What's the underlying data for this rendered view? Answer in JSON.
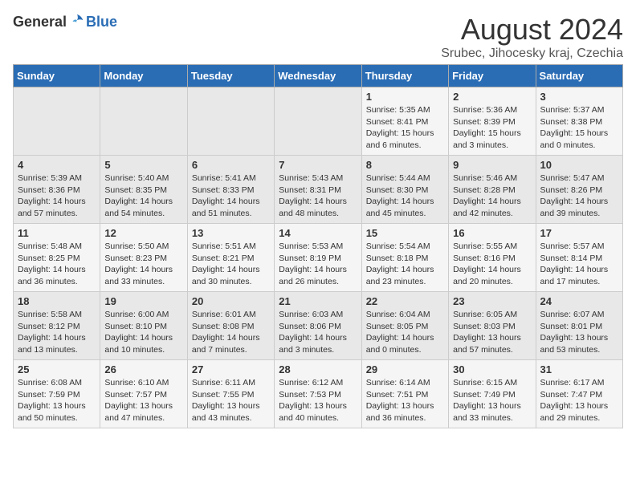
{
  "logo": {
    "general": "General",
    "blue": "Blue"
  },
  "title": "August 2024",
  "subtitle": "Srubec, Jihocesky kraj, Czechia",
  "weekdays": [
    "Sunday",
    "Monday",
    "Tuesday",
    "Wednesday",
    "Thursday",
    "Friday",
    "Saturday"
  ],
  "weeks": [
    [
      {
        "day": "",
        "info": ""
      },
      {
        "day": "",
        "info": ""
      },
      {
        "day": "",
        "info": ""
      },
      {
        "day": "",
        "info": ""
      },
      {
        "day": "1",
        "info": "Sunrise: 5:35 AM\nSunset: 8:41 PM\nDaylight: 15 hours\nand 6 minutes."
      },
      {
        "day": "2",
        "info": "Sunrise: 5:36 AM\nSunset: 8:39 PM\nDaylight: 15 hours\nand 3 minutes."
      },
      {
        "day": "3",
        "info": "Sunrise: 5:37 AM\nSunset: 8:38 PM\nDaylight: 15 hours\nand 0 minutes."
      }
    ],
    [
      {
        "day": "4",
        "info": "Sunrise: 5:39 AM\nSunset: 8:36 PM\nDaylight: 14 hours\nand 57 minutes."
      },
      {
        "day": "5",
        "info": "Sunrise: 5:40 AM\nSunset: 8:35 PM\nDaylight: 14 hours\nand 54 minutes."
      },
      {
        "day": "6",
        "info": "Sunrise: 5:41 AM\nSunset: 8:33 PM\nDaylight: 14 hours\nand 51 minutes."
      },
      {
        "day": "7",
        "info": "Sunrise: 5:43 AM\nSunset: 8:31 PM\nDaylight: 14 hours\nand 48 minutes."
      },
      {
        "day": "8",
        "info": "Sunrise: 5:44 AM\nSunset: 8:30 PM\nDaylight: 14 hours\nand 45 minutes."
      },
      {
        "day": "9",
        "info": "Sunrise: 5:46 AM\nSunset: 8:28 PM\nDaylight: 14 hours\nand 42 minutes."
      },
      {
        "day": "10",
        "info": "Sunrise: 5:47 AM\nSunset: 8:26 PM\nDaylight: 14 hours\nand 39 minutes."
      }
    ],
    [
      {
        "day": "11",
        "info": "Sunrise: 5:48 AM\nSunset: 8:25 PM\nDaylight: 14 hours\nand 36 minutes."
      },
      {
        "day": "12",
        "info": "Sunrise: 5:50 AM\nSunset: 8:23 PM\nDaylight: 14 hours\nand 33 minutes."
      },
      {
        "day": "13",
        "info": "Sunrise: 5:51 AM\nSunset: 8:21 PM\nDaylight: 14 hours\nand 30 minutes."
      },
      {
        "day": "14",
        "info": "Sunrise: 5:53 AM\nSunset: 8:19 PM\nDaylight: 14 hours\nand 26 minutes."
      },
      {
        "day": "15",
        "info": "Sunrise: 5:54 AM\nSunset: 8:18 PM\nDaylight: 14 hours\nand 23 minutes."
      },
      {
        "day": "16",
        "info": "Sunrise: 5:55 AM\nSunset: 8:16 PM\nDaylight: 14 hours\nand 20 minutes."
      },
      {
        "day": "17",
        "info": "Sunrise: 5:57 AM\nSunset: 8:14 PM\nDaylight: 14 hours\nand 17 minutes."
      }
    ],
    [
      {
        "day": "18",
        "info": "Sunrise: 5:58 AM\nSunset: 8:12 PM\nDaylight: 14 hours\nand 13 minutes."
      },
      {
        "day": "19",
        "info": "Sunrise: 6:00 AM\nSunset: 8:10 PM\nDaylight: 14 hours\nand 10 minutes."
      },
      {
        "day": "20",
        "info": "Sunrise: 6:01 AM\nSunset: 8:08 PM\nDaylight: 14 hours\nand 7 minutes."
      },
      {
        "day": "21",
        "info": "Sunrise: 6:03 AM\nSunset: 8:06 PM\nDaylight: 14 hours\nand 3 minutes."
      },
      {
        "day": "22",
        "info": "Sunrise: 6:04 AM\nSunset: 8:05 PM\nDaylight: 14 hours\nand 0 minutes."
      },
      {
        "day": "23",
        "info": "Sunrise: 6:05 AM\nSunset: 8:03 PM\nDaylight: 13 hours\nand 57 minutes."
      },
      {
        "day": "24",
        "info": "Sunrise: 6:07 AM\nSunset: 8:01 PM\nDaylight: 13 hours\nand 53 minutes."
      }
    ],
    [
      {
        "day": "25",
        "info": "Sunrise: 6:08 AM\nSunset: 7:59 PM\nDaylight: 13 hours\nand 50 minutes."
      },
      {
        "day": "26",
        "info": "Sunrise: 6:10 AM\nSunset: 7:57 PM\nDaylight: 13 hours\nand 47 minutes."
      },
      {
        "day": "27",
        "info": "Sunrise: 6:11 AM\nSunset: 7:55 PM\nDaylight: 13 hours\nand 43 minutes."
      },
      {
        "day": "28",
        "info": "Sunrise: 6:12 AM\nSunset: 7:53 PM\nDaylight: 13 hours\nand 40 minutes."
      },
      {
        "day": "29",
        "info": "Sunrise: 6:14 AM\nSunset: 7:51 PM\nDaylight: 13 hours\nand 36 minutes."
      },
      {
        "day": "30",
        "info": "Sunrise: 6:15 AM\nSunset: 7:49 PM\nDaylight: 13 hours\nand 33 minutes."
      },
      {
        "day": "31",
        "info": "Sunrise: 6:17 AM\nSunset: 7:47 PM\nDaylight: 13 hours\nand 29 minutes."
      }
    ]
  ]
}
